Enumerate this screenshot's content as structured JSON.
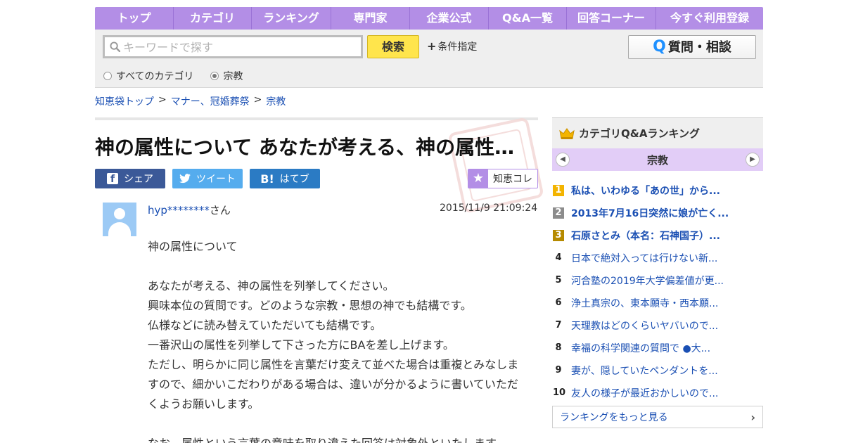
{
  "nav": {
    "items": [
      "トップ",
      "カテゴリ",
      "ランキング",
      "専門家",
      "企業公式",
      "Q&A一覧",
      "回答コーナー",
      "今すぐ利用登録"
    ]
  },
  "search": {
    "placeholder": "キーワードで探す",
    "button": "検索",
    "conditions": "条件指定",
    "ask_button": "質問・相談",
    "ask_icon_letter": "Q",
    "radio_all": "すべてのカテゴリ",
    "radio_current": "宗教",
    "selected": "宗教"
  },
  "breadcrumb": {
    "items": [
      "知恵袋トップ",
      "マナー、冠婚葬祭",
      "宗教"
    ],
    "separator": ">"
  },
  "question": {
    "title": "神の属性について あなたが考える、神の属性を列挙してください。",
    "share": {
      "facebook": "シェア",
      "twitter": "ツイート",
      "hatena": "はてブ",
      "hatena_icon": "B!"
    },
    "chie_label": "知恵コレ",
    "user_id": "hyp********",
    "user_suffix": "さん",
    "date": "2015/11/9  21:09:24",
    "body": [
      "神の属性について",
      "",
      "あなたが考える、神の属性を列挙してください。",
      "興味本位の質問です。どのような宗教・思想の神でも結構です。",
      "仏様などに読み替えていただいても結構です。",
      "一番沢山の属性を列挙して下さった方にBAを差し上げます。",
      "ただし、明らかに同じ属性を言葉だけ変えて並べた場合は重複とみなしま",
      "すので、細かいこだわりがある場合は、違いが分かるように書いていただ",
      "くようお願いします。",
      "",
      "なお、属性という言葉の意味を取り違えた回答は対象外といたします。"
    ]
  },
  "sidebar": {
    "title": "カテゴリQ&Aランキング",
    "category": "宗教",
    "ranking": [
      {
        "rank": "1",
        "text": "私は、いわゆる「あの世」から..."
      },
      {
        "rank": "2",
        "text": "2013年7月16日突然に娘が亡く..."
      },
      {
        "rank": "3",
        "text": "石原さとみ（本名：石神国子）..."
      },
      {
        "rank": "4",
        "text": "日本で絶対入っては行けない新..."
      },
      {
        "rank": "5",
        "text": "河合塾の2019年大学偏差値が更..."
      },
      {
        "rank": "6",
        "text": "浄土真宗の、東本願寺・西本願..."
      },
      {
        "rank": "7",
        "text": "天理教はどのくらいヤバいので..."
      },
      {
        "rank": "8",
        "text": "幸福の科学関連の質問で ●大..."
      },
      {
        "rank": "9",
        "text": "妻が、隠していたペンダントを..."
      },
      {
        "rank": "10",
        "text": "友人の様子が最近おかしいので..."
      }
    ],
    "more": "ランキングをもっと見る"
  },
  "colors": {
    "nav_bg": "#b38ee6",
    "search_button": "#ffe54c",
    "link": "#1a4fb3",
    "facebook": "#3b5998",
    "twitter": "#55acee",
    "hatena": "#2b7bc4",
    "category_bar": "#e2cdf7"
  }
}
